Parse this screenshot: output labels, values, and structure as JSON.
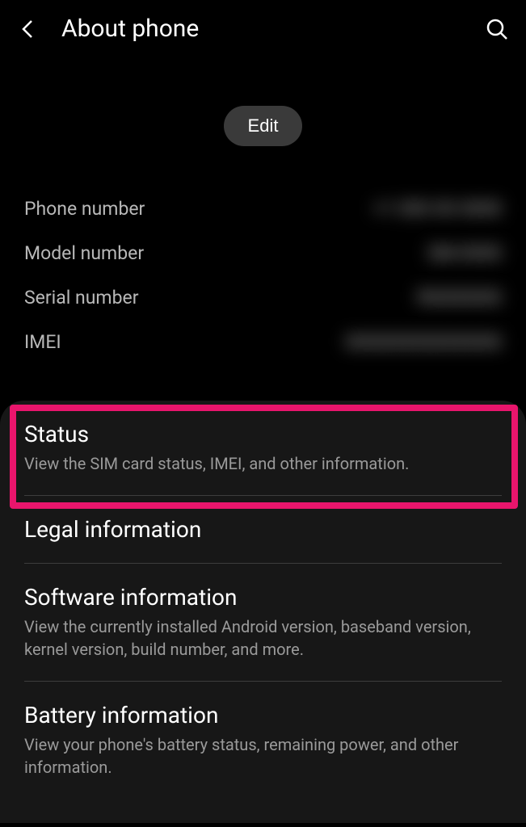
{
  "header": {
    "title": "About phone"
  },
  "edit_button": "Edit",
  "info": [
    {
      "label": "Phone number",
      "value": "+1 000 00 0000"
    },
    {
      "label": "Model number",
      "value": "SM-0000"
    },
    {
      "label": "Serial number",
      "value": "R0000000"
    },
    {
      "label": "IMEI",
      "value": "000000000000000"
    }
  ],
  "list": [
    {
      "title": "Status",
      "subtitle": "View the SIM card status, IMEI, and other information."
    },
    {
      "title": "Legal information",
      "subtitle": ""
    },
    {
      "title": "Software information",
      "subtitle": "View the currently installed Android version, baseband version, kernel version, build number, and more."
    },
    {
      "title": "Battery information",
      "subtitle": "View your phone's battery status, remaining power, and other information."
    }
  ]
}
